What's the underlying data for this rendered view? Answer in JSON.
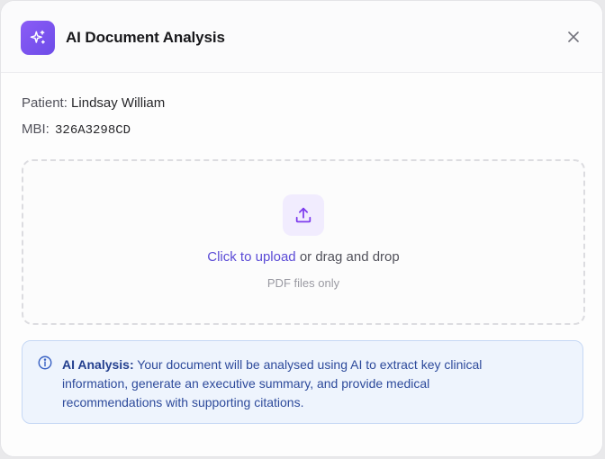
{
  "header": {
    "title": "AI Document Analysis",
    "icon": "sparkles-icon",
    "close_icon": "close-icon"
  },
  "patient": {
    "name_label": "Patient:",
    "name": "Lindsay William",
    "mbi_label": "MBI:",
    "mbi": "326A3298CD"
  },
  "upload": {
    "icon": "upload-icon",
    "link_text": "Click to upload",
    "rest_text": " or drag and drop",
    "hint": "PDF files only"
  },
  "info": {
    "icon": "info-icon",
    "title": "AI Analysis:",
    "text": " Your document will be analysed using AI to extract key clinical information, generate an executive summary, and provide medical recommendations with supporting citations."
  },
  "colors": {
    "accent": "#6d4ce8",
    "link": "#5b4bd6",
    "info_bg": "#eef4fd",
    "info_text": "#2d4a9b"
  }
}
